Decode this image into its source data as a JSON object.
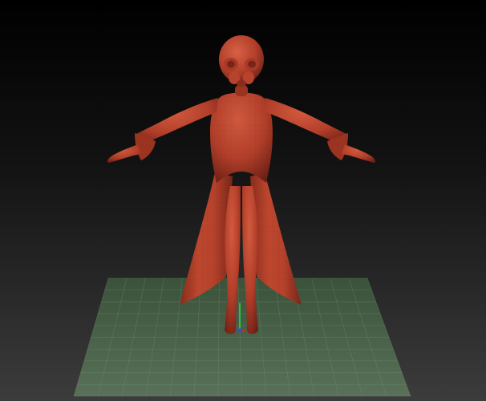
{
  "viewport": {
    "label": "",
    "background_top": "#000000",
    "background_bottom": "#3c3c3c"
  },
  "model": {
    "material_color": "#b8402a",
    "highlight_color": "#d0563a",
    "shadow_color": "#5e1a10"
  },
  "floor_grid": {
    "visible": true,
    "color": "#4e6b4e",
    "line_color": "#6f8f6f"
  },
  "gizmo": {
    "x_axis_color": "#c03030",
    "y_axis_color": "#30c040",
    "z_axis_color": "#3050d0"
  }
}
